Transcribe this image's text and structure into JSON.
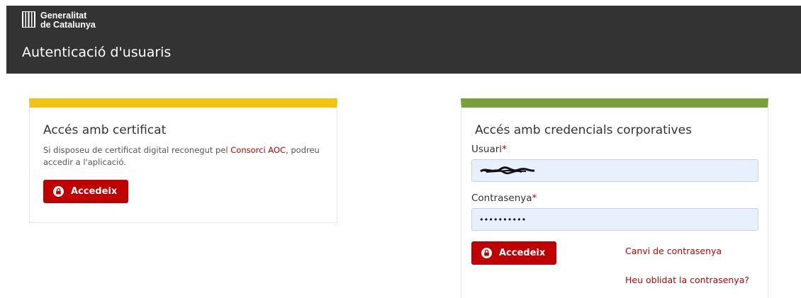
{
  "header": {
    "logo_line1": "Generalitat",
    "logo_line2": "de Catalunya",
    "title": "Autenticació d'usuaris",
    "background": "#333333"
  },
  "certificate_card": {
    "title": "Accés amb certificat",
    "desc_before": "Si disposeu de certificat digital reconegut pel ",
    "desc_link": "Consorci AOC",
    "desc_after": ", podreu accedir a l'aplicació.",
    "button_label": "Accedeix",
    "accent": "#f2c40f"
  },
  "credentials_card": {
    "title": "Accés amb credencials corporatives",
    "user_label": "Usuari",
    "password_label": "Contrasenya",
    "required_mark": "*",
    "password_value": "••••••••••",
    "button_label": "Accedeix",
    "change_password_link": "Canvi de contrasenya",
    "forgot_password_link": "Heu oblidat la contrasenya?",
    "accent": "#76a03a"
  },
  "colors": {
    "primary_button": "#c00000",
    "input_background": "#e8f0fe"
  },
  "icons": {
    "logo": "generalitat-logo-icon",
    "lock": "lock-icon"
  }
}
